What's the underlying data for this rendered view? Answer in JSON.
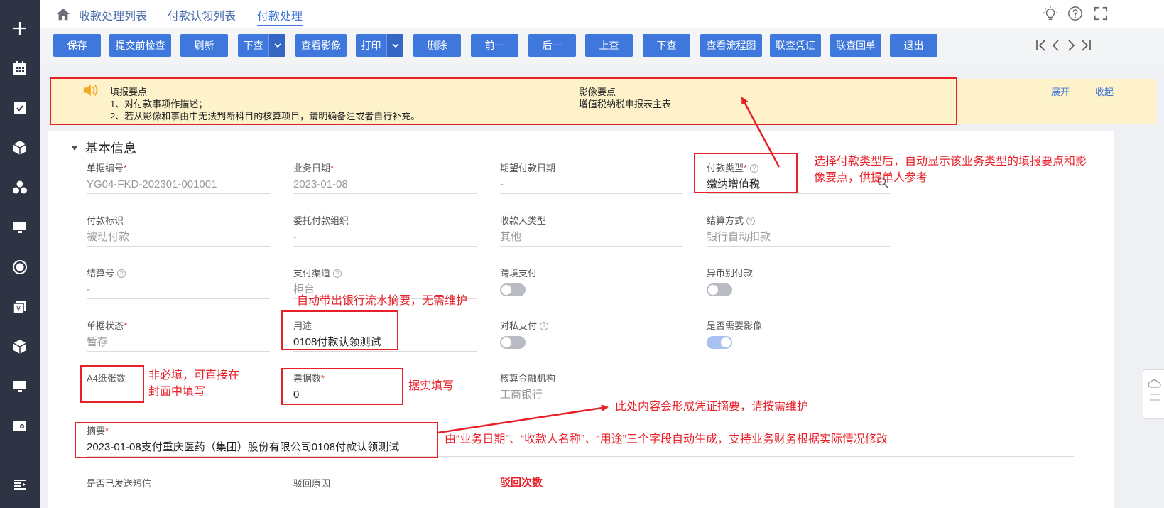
{
  "tabs": [
    {
      "label": "收款处理列表"
    },
    {
      "label": "付款认领列表"
    },
    {
      "label": "付款处理"
    }
  ],
  "toolbar": {
    "save": "保存",
    "precheck": "提交前检查",
    "refresh": "刷新",
    "down_query": "下查",
    "view_image": "查看影像",
    "print": "打印",
    "delete": "删除",
    "prev": "前一",
    "next": "后一",
    "up_query": "上查",
    "down_query2": "下查",
    "flowchart": "查看流程图",
    "voucher": "联查凭证",
    "receipt": "联查回单",
    "exit": "退出"
  },
  "notice": {
    "fill_title": "填报要点",
    "fill_line1": "1、对付款事项作描述；",
    "fill_line2": "2、若从影像和事由中无法判断科目的核算项目，请明确备注或者自行补充。",
    "image_title": "影像要点",
    "image_line1": "增值税纳税申报表主表",
    "expand": "展开",
    "collapse": "收起"
  },
  "section": {
    "title": "基本信息"
  },
  "fields": {
    "doc_no": {
      "label": "单据编号",
      "value": "YG04-FKD-202301-001001"
    },
    "biz_date": {
      "label": "业务日期",
      "value": "2023-01-08"
    },
    "expect_date": {
      "label": "期望付款日期",
      "value": "-"
    },
    "pay_type": {
      "label": "付款类型",
      "value": "缴纳增值税"
    },
    "pay_flag": {
      "label": "付款标识",
      "value": "被动付款"
    },
    "entrust_org": {
      "label": "委托付款组织",
      "value": "-"
    },
    "payee_type": {
      "label": "收款人类型",
      "value": "其他"
    },
    "settle_method": {
      "label": "结算方式",
      "value": "银行自动扣款"
    },
    "settle_no": {
      "label": "结算号",
      "value": "-"
    },
    "pay_channel": {
      "label": "支付渠道",
      "value": "柜台"
    },
    "cross_border": {
      "label": "跨境支付"
    },
    "diff_currency": {
      "label": "异币别付款"
    },
    "doc_status": {
      "label": "单据状态",
      "value": "暂存"
    },
    "purpose": {
      "label": "用途",
      "value": "0108付款认领测试"
    },
    "private_pay": {
      "label": "对私支付"
    },
    "need_image": {
      "label": "是否需要影像"
    },
    "a4_count": {
      "label": "A4纸张数",
      "value": ""
    },
    "bill_count": {
      "label": "票据数",
      "value": "0"
    },
    "account_bank": {
      "label": "核算金融机构",
      "value": "工商银行"
    },
    "summary": {
      "label": "摘要",
      "value": "2023-01-08支付重庆医药（集团）股份有限公司0108付款认领测试"
    },
    "sms_sent": {
      "label": "是否已发送短信"
    },
    "reject_reason": {
      "label": "驳回原因"
    },
    "reject_count": {
      "label": "驳回次数"
    }
  },
  "annotations": {
    "pay_type_note_1": "选择付款类型后，自动显示该业务类型的填报要点和影",
    "pay_type_note_2": "像要点，供提单人参考",
    "purpose_note": "自动带出银行流水摘要，无需维护",
    "a4_note_1": "非必填，可直接在",
    "a4_note_2": "封面中填写",
    "bill_note": "据实填写",
    "voucher_note": "此处内容会形成凭证摘要，请按需维护",
    "summary_note": "由“业务日期”、“收款人名称”、“用途”三个字段自动生成，支持业务财务根据实际情况修改"
  },
  "colors": {
    "primary": "#3f78dc",
    "sidebar": "#2f3444",
    "notice_bg": "#fdf2c9",
    "annotation": "#e8202a"
  }
}
